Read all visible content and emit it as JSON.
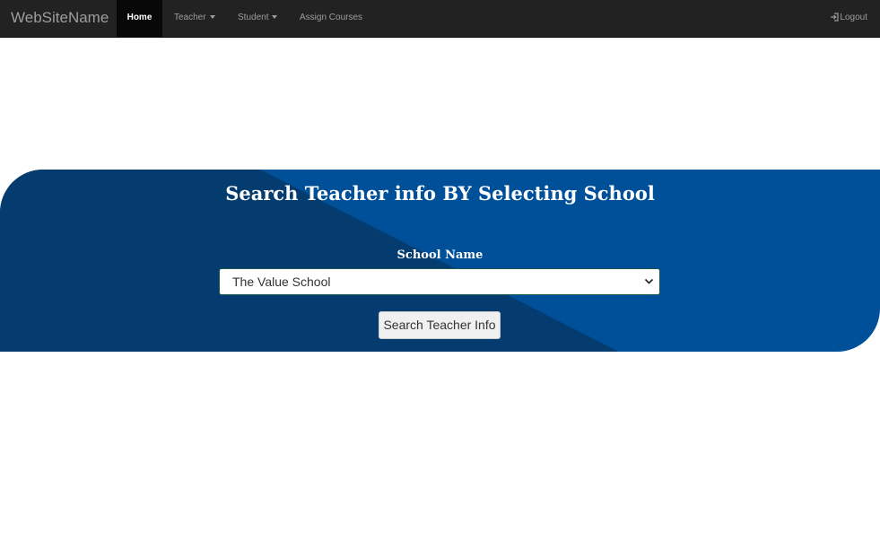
{
  "navbar": {
    "brand": "WebSiteName",
    "items": [
      {
        "label": "Home",
        "active": true
      },
      {
        "label": "Teacher",
        "dropdown": true
      },
      {
        "label": "Student",
        "dropdown": true
      },
      {
        "label": "Assign Courses"
      }
    ],
    "logout_label": "Logout",
    "logout_icon": "log-in-icon"
  },
  "hero": {
    "title": "Search Teacher info BY Selecting School",
    "field_label": "School Name",
    "select_value": "The Value School",
    "button_label": "Search Teacher Info"
  },
  "colors": {
    "navbar_bg": "#222222",
    "hero_dark": "#043c70",
    "hero_light": "#005099"
  }
}
